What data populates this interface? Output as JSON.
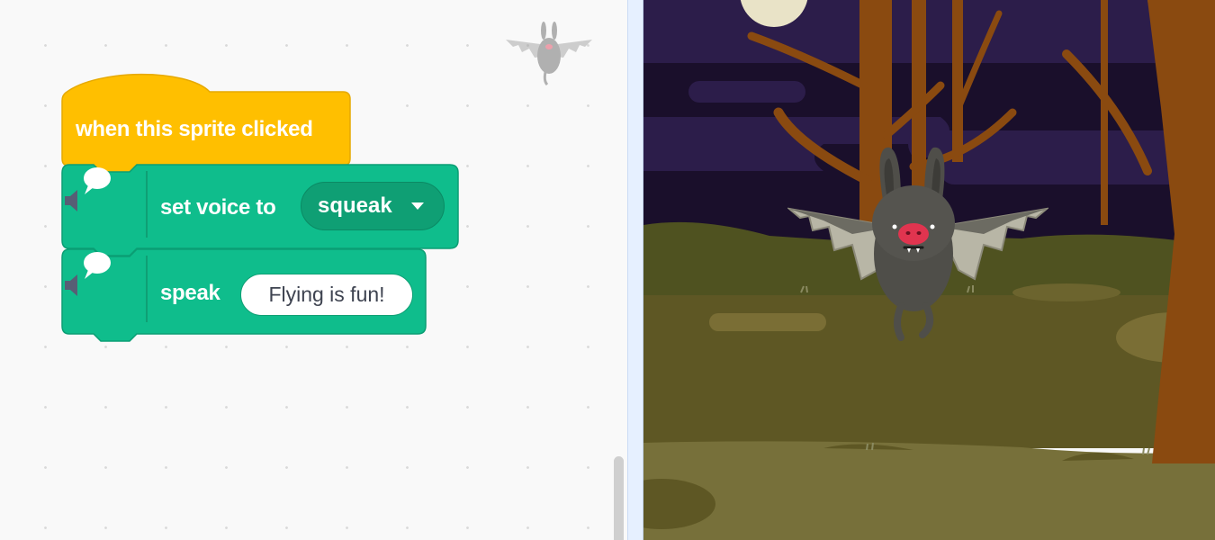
{
  "code": {
    "hat_block": {
      "label": "when this sprite clicked",
      "color": "#ffbf00"
    },
    "voice_block": {
      "label": "set voice to",
      "voice_value": "squeak",
      "color": "#0fbd8c",
      "icon": "speech-bubble-speaker-icon"
    },
    "speak_block": {
      "label": "speak",
      "input_value": "Flying is fun!",
      "color": "#0fbd8c",
      "icon": "speech-bubble-speaker-icon"
    }
  },
  "stage": {
    "sprite": "bat",
    "backdrop": "woods-night"
  }
}
